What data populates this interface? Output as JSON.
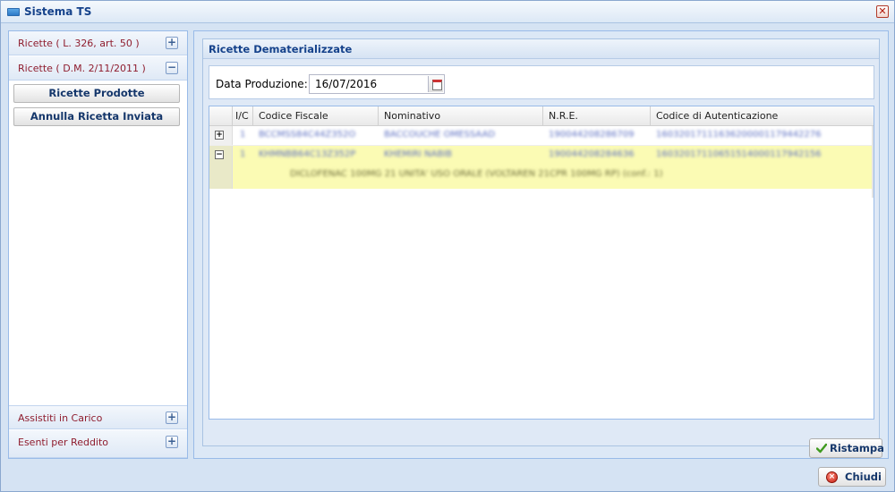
{
  "window": {
    "title": "Sistema TS",
    "close_glyph": "✕"
  },
  "sidebar": {
    "sections": [
      {
        "label": "Ricette ( L. 326, art. 50 )",
        "toggle": "+"
      },
      {
        "label": "Ricette ( D.M. 2/11/2011 )",
        "toggle": "−"
      },
      {
        "label": "Assistiti in Carico",
        "toggle": "+"
      },
      {
        "label": "Esenti per Reddito",
        "toggle": "+"
      }
    ],
    "buttons": [
      {
        "label": "Ricette Prodotte"
      },
      {
        "label": "Annulla Ricetta Inviata"
      }
    ]
  },
  "main": {
    "panel_title": "Ricette Dematerializzate",
    "form": {
      "date_label": "Data Produzione:",
      "date_value": "16/07/2016"
    },
    "grid": {
      "columns": [
        "I/C",
        "Codice Fiscale",
        "Nominativo",
        "N.R.E.",
        "Codice di Autenticazione"
      ],
      "rows": [
        {
          "expander": "+",
          "ic": "1",
          "codice_fiscale": "BCCMSS84C44Z352O",
          "nominativo": "BACCOUCHE OMESSAAD",
          "nre": "190044208286709",
          "auth": "16032017111636200001179442276"
        },
        {
          "expander": "−",
          "ic": "1",
          "codice_fiscale": "KHMNBB64C13Z352P",
          "nominativo": "KHEMIRI NABIB",
          "nre": "190044208284636",
          "auth": "16032017110651514000117942156",
          "detail": "DICLOFENAC 100MG 21 UNITA' USO ORALE (VOLTAREN 21CPR 100MG RP) (conf.: 1)"
        }
      ]
    },
    "ristampa_label": "Ristampa"
  },
  "footer": {
    "close_label": "Chiudi",
    "close_glyph": "×"
  },
  "colors": {
    "accent": "#15428b",
    "sidebar_label": "#8f1d2e",
    "selected_row": "#fbfbb4"
  }
}
